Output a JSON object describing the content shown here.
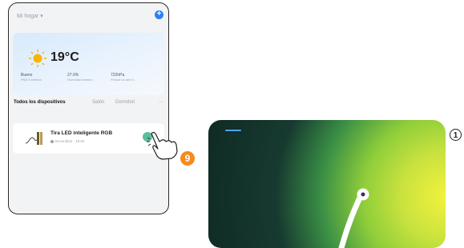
{
  "home": {
    "title": "Mi hogar",
    "add_icon": "plus",
    "weather": {
      "temperature": "19°C",
      "stats": [
        {
          "value": "Bueno",
          "label": "PM2.5 exterior"
        },
        {
          "value": "27.0%",
          "label": "Humedad exterior"
        },
        {
          "value": "722hPa",
          "label": "Presión al aire li..."
        }
      ]
    },
    "tabs": [
      "Todos los dispositivos",
      "Salón",
      "Dormitori",
      "···"
    ],
    "device": {
      "name": "Tira LED inteligente RGB",
      "status": "Encendido · 10:0s"
    }
  },
  "callouts": {
    "step_9": "9",
    "step_1": "1"
  },
  "colors": {
    "accent": "#2f80ed",
    "power": "#5bbf9b",
    "badge_orange": "#f28c1e",
    "dark_panel": "#0f2a24"
  }
}
